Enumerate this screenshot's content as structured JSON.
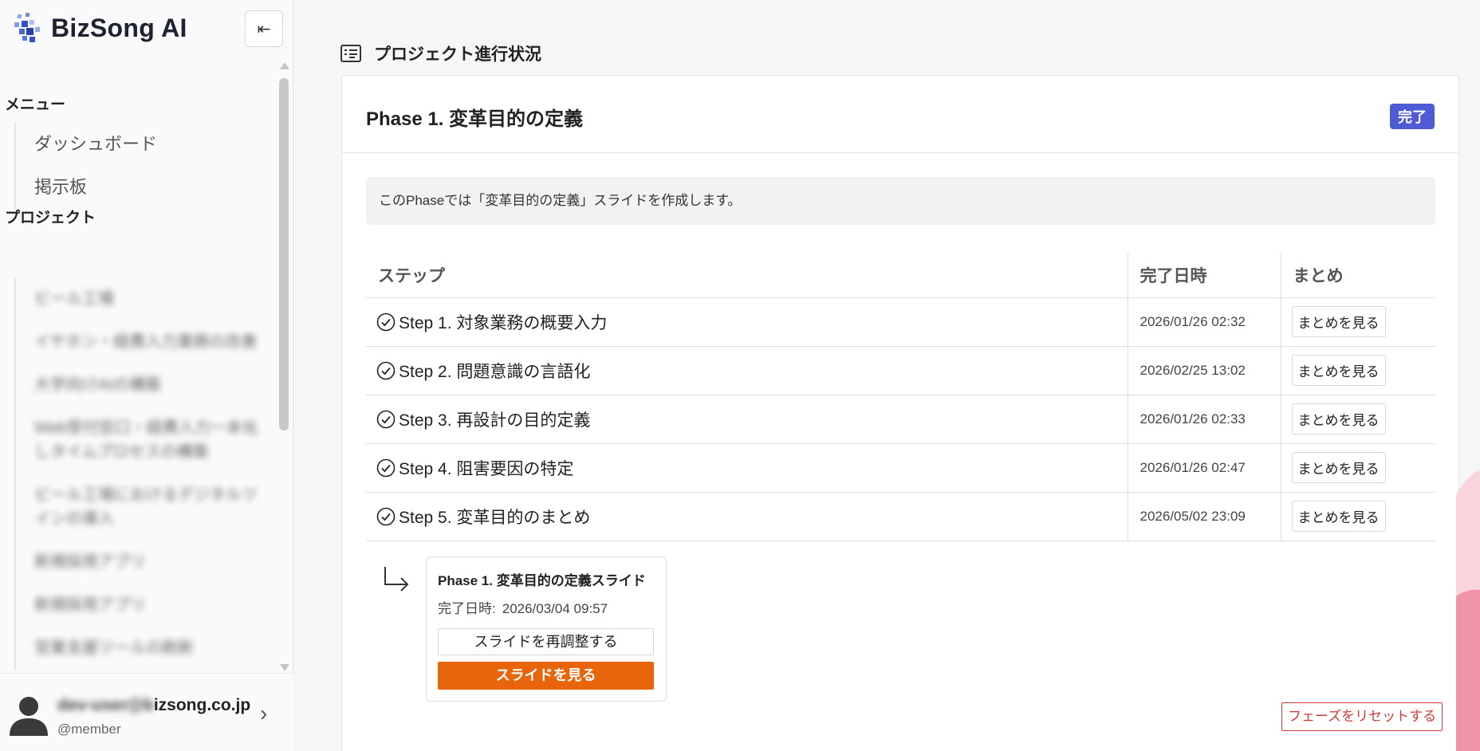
{
  "app": {
    "brand_name": "BizSong AI"
  },
  "sidebar": {
    "collapse_icon": "⇤",
    "menu_title": "メニュー",
    "menu_items": [
      {
        "label": "ダッシュボード"
      },
      {
        "label": "掲示板"
      }
    ],
    "projects_title": "プロジェクト",
    "projects": [
      {
        "label": "ビール工場"
      },
      {
        "label": "イヤホン・経費入力業務の改善"
      },
      {
        "label": "大学向けAIの構築"
      },
      {
        "label": "Web受付窓口・経費入力一本化しタイムプロセスの構築"
      },
      {
        "label": "ビール工場におけるデジタルツインの導入"
      },
      {
        "label": "新規採用アプリ"
      },
      {
        "label": "新規採用アプリ"
      },
      {
        "label": "営業支援ツールの刷新"
      }
    ]
  },
  "user": {
    "email_hidden": "dev-user@b",
    "email_visible": "izsong.co.jp",
    "role": "@member"
  },
  "page": {
    "title": "プロジェクト進行状況"
  },
  "phase": {
    "title": "Phase 1. 変革目的の定義",
    "status": "完了",
    "status_color": "#4f5bd5",
    "description": "このPhaseでは「変革目的の定義」スライドを作成します。",
    "table_headers": {
      "step": "ステップ",
      "date": "完了日時",
      "summary": "まとめ"
    },
    "steps": [
      {
        "label": "Step 1. 対象業務の概要入力",
        "date": "2026/01/26 02:32",
        "action": "まとめを見る"
      },
      {
        "label": "Step 2. 問題意識の言語化",
        "date": "2026/02/25 13:02",
        "action": "まとめを見る"
      },
      {
        "label": "Step 3. 再設計の目的定義",
        "date": "2026/01/26 02:33",
        "action": "まとめを見る"
      },
      {
        "label": "Step 4. 阻害要因の特定",
        "date": "2026/01/26 02:47",
        "action": "まとめを見る"
      },
      {
        "label": "Step 5. 変革目的のまとめ",
        "date": "2026/05/02 23:09",
        "action": "まとめを見る"
      }
    ],
    "slide": {
      "title": "Phase 1. 変革目的の定義スライド",
      "date_label": "完了日時:",
      "date": "2026/03/04 09:57",
      "readjust_label": "スライドを再調整する",
      "view_label": "スライドを見る",
      "view_color": "#e8650b"
    },
    "reset_label": "フェーズをリセットする",
    "reset_color": "#d23a3a"
  }
}
